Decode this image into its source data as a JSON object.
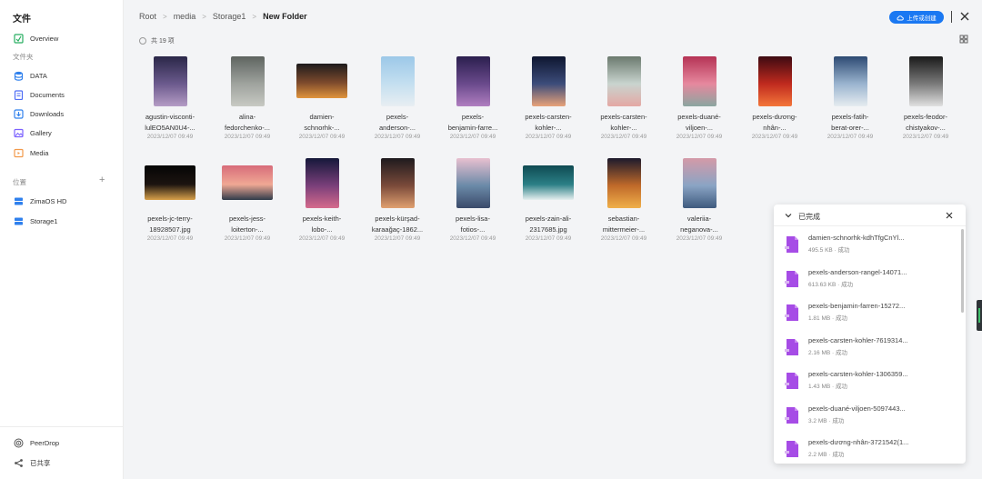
{
  "sidebar": {
    "title": "文件",
    "overview": "Overview",
    "files_section": "文件夹",
    "folders": [
      {
        "label": "DATA",
        "color": "#2f80ed",
        "icon": "database-icon"
      },
      {
        "label": "Documents",
        "color": "#4f6df5",
        "icon": "document-icon"
      },
      {
        "label": "Downloads",
        "color": "#2f80ed",
        "icon": "download-icon"
      },
      {
        "label": "Gallery",
        "color": "#7b61ff",
        "icon": "gallery-icon"
      },
      {
        "label": "Media",
        "color": "#f2994a",
        "icon": "media-icon"
      }
    ],
    "locations_section": "位置",
    "locations": [
      {
        "label": "ZimaOS HD"
      },
      {
        "label": "Storage1"
      }
    ],
    "peerdrop": "PeerDrop",
    "shared": "已共享"
  },
  "breadcrumb": {
    "items": [
      "Root",
      "media",
      "Storage1"
    ],
    "current": "New Folder"
  },
  "toolbar": {
    "upload_label": "上传或创建"
  },
  "count_label": "共 19 项",
  "files": [
    {
      "name": "agustin-visconti-\nlulEO5AN0U4-...",
      "date": "2023/12/07 09:49",
      "orient": "portrait",
      "colors": [
        "#2a2748",
        "#6b5a8d",
        "#b59cc5"
      ]
    },
    {
      "name": "alina-\nfedorchenko-...",
      "date": "2023/12/07 09:49",
      "orient": "portrait",
      "colors": [
        "#5e6460",
        "#9fa39e",
        "#c7c9c3"
      ]
    },
    {
      "name": "damien-\nschnorhk-...",
      "date": "2023/12/07 09:49",
      "orient": "landscape",
      "colors": [
        "#1d1b1c",
        "#7d4a2c",
        "#e0943c"
      ]
    },
    {
      "name": "pexels-\nanderson-...",
      "date": "2023/12/07 09:49",
      "orient": "portrait",
      "colors": [
        "#9cc8e8",
        "#c4dff0",
        "#e8eef2"
      ]
    },
    {
      "name": "pexels-\nbenjamin-farre...",
      "date": "2023/12/07 09:49",
      "orient": "portrait",
      "colors": [
        "#2b1f4e",
        "#6a4a8c",
        "#b07ec0"
      ]
    },
    {
      "name": "pexels-carsten-\nkohler-...",
      "date": "2023/12/07 09:49",
      "orient": "portrait",
      "colors": [
        "#0e1630",
        "#3c4c7a",
        "#e8a279"
      ]
    },
    {
      "name": "pexels-carsten-\nkohler-...",
      "date": "2023/12/07 09:49",
      "orient": "portrait",
      "colors": [
        "#6b7a6e",
        "#c9d4cf",
        "#e4a8a4"
      ]
    },
    {
      "name": "pexels-duané-\nviljoen-...",
      "date": "2023/12/07 09:49",
      "orient": "portrait",
      "colors": [
        "#b53355",
        "#e6889e",
        "#8aa6a0"
      ]
    },
    {
      "name": "pexels-dương-\nnhân-...",
      "date": "2023/12/07 09:49",
      "orient": "portrait",
      "colors": [
        "#3d0a12",
        "#c02a1e",
        "#f3763a"
      ]
    },
    {
      "name": "pexels-fatih-\nberat-orer-...",
      "date": "2023/12/07 09:49",
      "orient": "portrait",
      "colors": [
        "#2d4a73",
        "#9ab4cf",
        "#e6ecf0"
      ]
    },
    {
      "name": "pexels-feodor-\nchistyakov-...",
      "date": "2023/12/07 09:49",
      "orient": "portrait",
      "colors": [
        "#1a1a1a",
        "#7a7a7a",
        "#e0e0e0"
      ]
    },
    {
      "name": "pexels-jc-terry-\n18928507.jpg",
      "date": "2023/12/07 09:49",
      "orient": "landscape",
      "colors": [
        "#050505",
        "#1c1410",
        "#d8a04a"
      ]
    },
    {
      "name": "pexels-jess-\nloiterton-...",
      "date": "2023/12/07 09:49",
      "orient": "landscape",
      "colors": [
        "#d76c7a",
        "#f0a894",
        "#2f3b4a"
      ]
    },
    {
      "name": "pexels-keith-\nlobo-...",
      "date": "2023/12/07 09:49",
      "orient": "portrait",
      "colors": [
        "#15183a",
        "#7a3f7a",
        "#d56a8c"
      ]
    },
    {
      "name": "pexels-kürşad-\nkaraağaç-1862...",
      "date": "2023/12/07 09:49",
      "orient": "portrait",
      "colors": [
        "#1e1a1e",
        "#7a4a3a",
        "#e0a070"
      ]
    },
    {
      "name": "pexels-lisa-\nfotios-...",
      "date": "2023/12/07 09:49",
      "orient": "portrait",
      "colors": [
        "#e8c0d0",
        "#6b8aa8",
        "#3a4a6a"
      ]
    },
    {
      "name": "pexels-zain-ali-\n2317685.jpg",
      "date": "2023/12/07 09:49",
      "orient": "landscape",
      "colors": [
        "#0f4a52",
        "#2b7f86",
        "#e6efef"
      ]
    },
    {
      "name": "sebastian-\nmittermeier-...",
      "date": "2023/12/07 09:49",
      "orient": "portrait",
      "colors": [
        "#1c1a2c",
        "#c06a2a",
        "#f0b04a"
      ]
    },
    {
      "name": "valeriia-\nneganova-...",
      "date": "2023/12/07 09:49",
      "orient": "portrait",
      "colors": [
        "#d49aa8",
        "#8aa4c4",
        "#3e5a7e"
      ]
    }
  ],
  "upload_panel": {
    "title": "已完成",
    "items": [
      {
        "name": "damien-schnorhk-kdhTfgCnYl...",
        "size": "495.5 KB",
        "status": "成功"
      },
      {
        "name": "pexels-anderson-rangel-14071...",
        "size": "613.63 KB",
        "status": "成功"
      },
      {
        "name": "pexels-benjamin-farren-15272...",
        "size": "1.81 MB",
        "status": "成功"
      },
      {
        "name": "pexels-carsten-kohler-7619314...",
        "size": "2.16 MB",
        "status": "成功"
      },
      {
        "name": "pexels-carsten-kohler-1306359...",
        "size": "1.43 MB",
        "status": "成功"
      },
      {
        "name": "pexels-duané-viljoen-5097443...",
        "size": "3.2 MB",
        "status": "成功"
      },
      {
        "name": "pexels-dương-nhân-3721542(1...",
        "size": "2.2 MB",
        "status": "成功"
      }
    ]
  }
}
